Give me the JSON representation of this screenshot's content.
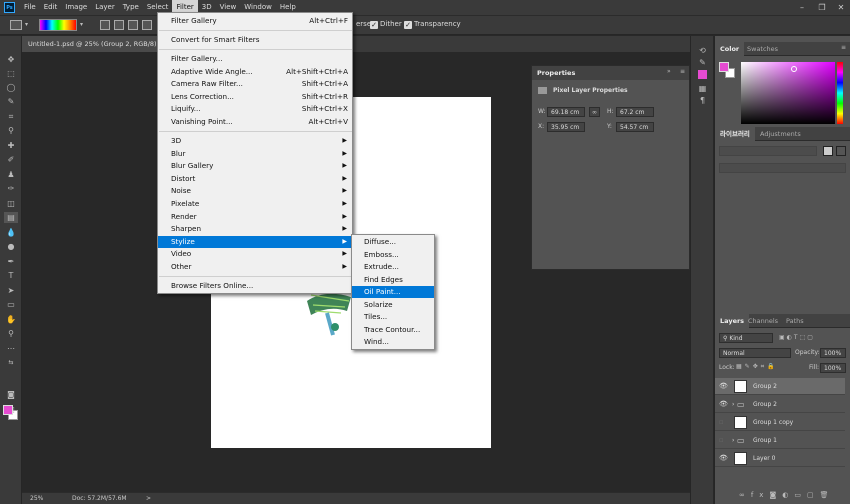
{
  "app": {
    "logo": "Ps"
  },
  "menubar": {
    "items": [
      "File",
      "Edit",
      "Image",
      "Layer",
      "Type",
      "Select",
      "Filter",
      "3D",
      "View",
      "Window",
      "Help"
    ],
    "active": "Filter"
  },
  "options_bar": {
    "checkbox_labels": [
      "erse",
      "Dither",
      "Transparency"
    ]
  },
  "document": {
    "tab_title": "Untitled-1.psd @ 25% (Group 2, RGB/8)",
    "close_glyph": "×"
  },
  "status": {
    "zoom": "25%",
    "doc_info": "Doc: 57.2M/57.6M",
    "arrow": ">"
  },
  "filter_menu": {
    "items": [
      {
        "label": "Filter Gallery",
        "shortcut": "Alt+Ctrl+F"
      },
      {
        "label": "Convert for Smart Filters",
        "shortcut": ""
      },
      {
        "label": "Filter Gallery...",
        "shortcut": ""
      },
      {
        "label": "Adaptive Wide Angle...",
        "shortcut": "Alt+Shift+Ctrl+A"
      },
      {
        "label": "Camera Raw Filter...",
        "shortcut": "Shift+Ctrl+A"
      },
      {
        "label": "Lens Correction...",
        "shortcut": "Shift+Ctrl+R"
      },
      {
        "label": "Liquify...",
        "shortcut": "Shift+Ctrl+X"
      },
      {
        "label": "Vanishing Point...",
        "shortcut": "Alt+Ctrl+V"
      },
      {
        "label": "3D",
        "shortcut": ""
      },
      {
        "label": "Blur",
        "shortcut": ""
      },
      {
        "label": "Blur Gallery",
        "shortcut": ""
      },
      {
        "label": "Distort",
        "shortcut": ""
      },
      {
        "label": "Noise",
        "shortcut": ""
      },
      {
        "label": "Pixelate",
        "shortcut": ""
      },
      {
        "label": "Render",
        "shortcut": ""
      },
      {
        "label": "Sharpen",
        "shortcut": ""
      },
      {
        "label": "Stylize",
        "shortcut": ""
      },
      {
        "label": "Video",
        "shortcut": ""
      },
      {
        "label": "Other",
        "shortcut": ""
      },
      {
        "label": "Browse Filters Online...",
        "shortcut": ""
      }
    ],
    "highlighted": "Stylize"
  },
  "stylize_menu": {
    "items": [
      "Diffuse...",
      "Emboss...",
      "Extrude...",
      "Find Edges",
      "Oil Paint...",
      "Solarize",
      "Tiles...",
      "Trace Contour...",
      "Wind..."
    ],
    "highlighted": "Oil Paint..."
  },
  "properties_panel": {
    "title": "Properties",
    "subtitle": "Pixel Layer Properties",
    "w_label": "W:",
    "w": "69.18 cm",
    "h_label": "H:",
    "h": "67.2 cm",
    "x_label": "X:",
    "x": "35.95 cm",
    "y_label": "Y:",
    "y": "54.57 cm"
  },
  "color_panel": {
    "tabs": [
      "Color",
      "Swatches"
    ],
    "foreground": "#e64bd1",
    "background": "#ffffff"
  },
  "libraries_panel": {
    "tabs": [
      "라이브러리",
      "Adjustments"
    ]
  },
  "layers_panel": {
    "tabs": [
      "Layers",
      "Channels",
      "Paths"
    ],
    "filter": "Kind",
    "blend_mode": "Normal",
    "opacity_label": "Opacity:",
    "opacity": "100%",
    "lock_label": "Lock:",
    "fill_label": "Fill:",
    "fill": "100%",
    "layers": [
      {
        "name": "Group 2",
        "visible": true,
        "selected": true
      },
      {
        "name": "Group 2",
        "visible": true,
        "selected": false
      },
      {
        "name": "Group 1 copy",
        "visible": false,
        "selected": false
      },
      {
        "name": "Group 1",
        "visible": false,
        "selected": false
      },
      {
        "name": "Layer 0",
        "visible": true,
        "selected": false
      }
    ],
    "footer_icons": [
      "link-icon",
      "fx-icon",
      "mask-icon",
      "adjustment-icon",
      "folder-icon",
      "new-layer-icon",
      "trash-icon"
    ]
  }
}
